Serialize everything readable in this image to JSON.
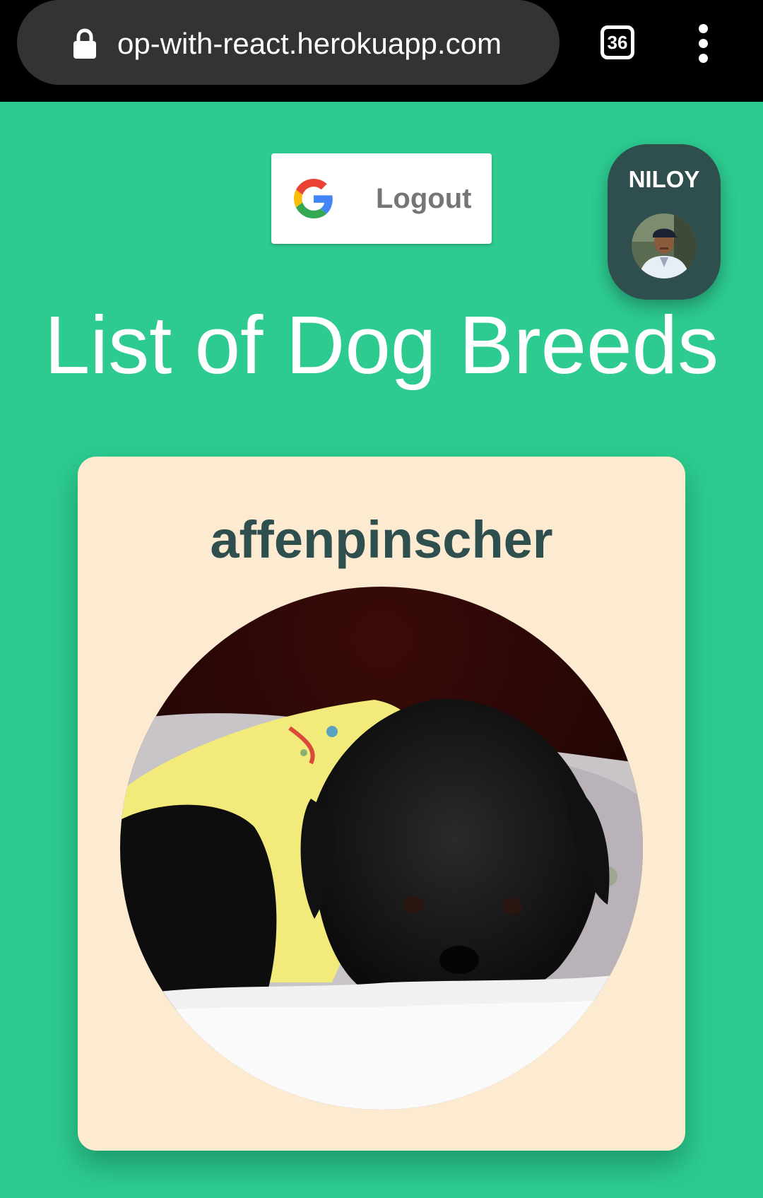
{
  "browser": {
    "url": "op-with-react.herokuapp.com",
    "tab_count": "36"
  },
  "header": {
    "logout_label": "Logout",
    "user_name": "NILOY"
  },
  "page": {
    "title": "List of Dog Breeds"
  },
  "breeds": [
    {
      "name": "affenpinscher"
    }
  ],
  "colors": {
    "background": "#2dcb90",
    "card": "#fdebd1",
    "accent_dark": "#2f4f4f"
  },
  "icons": [
    "lock-icon",
    "tabs-icon",
    "menu-icon",
    "google-icon"
  ]
}
